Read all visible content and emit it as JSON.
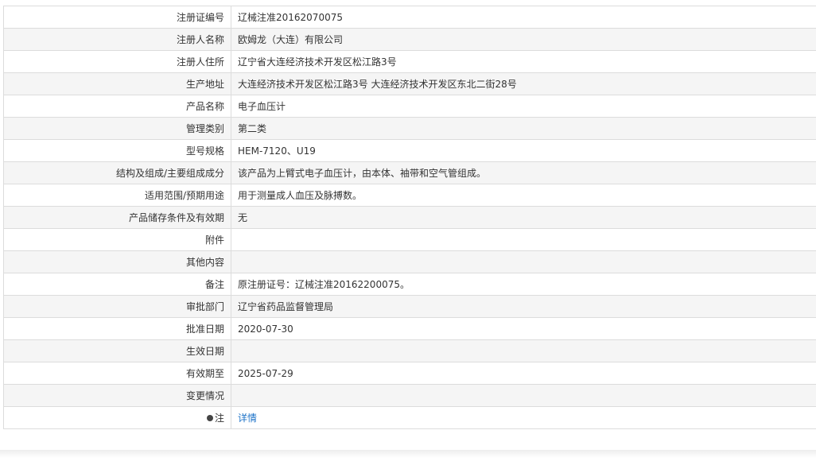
{
  "rows": [
    {
      "label": "注册证编号",
      "value": "辽械注准20162070075"
    },
    {
      "label": "注册人名称",
      "value": "欧姆龙（大连）有限公司"
    },
    {
      "label": "注册人住所",
      "value": "辽宁省大连经济技术开发区松江路3号"
    },
    {
      "label": "生产地址",
      "value": "大连经济技术开发区松江路3号  大连经济技术开发区东北二街28号"
    },
    {
      "label": "产品名称",
      "value": "电子血压计"
    },
    {
      "label": "管理类别",
      "value": "第二类"
    },
    {
      "label": "型号规格",
      "value": "HEM-7120、U19"
    },
    {
      "label": "结构及组成/主要组成成分",
      "value": "该产品为上臂式电子血压计，由本体、袖带和空气管组成。"
    },
    {
      "label": "适用范围/预期用途",
      "value": "用于测量成人血压及脉搏数。"
    },
    {
      "label": "产品储存条件及有效期",
      "value": "无"
    },
    {
      "label": "附件",
      "value": ""
    },
    {
      "label": "其他内容",
      "value": ""
    },
    {
      "label": "备注",
      "value": "原注册证号：辽械注准20162200075。"
    },
    {
      "label": "审批部门",
      "value": "辽宁省药品监督管理局"
    },
    {
      "label": "批准日期",
      "value": "2020-07-30"
    },
    {
      "label": "生效日期",
      "value": ""
    },
    {
      "label": "有效期至",
      "value": "2025-07-29"
    },
    {
      "label": "变更情况",
      "value": ""
    }
  ],
  "note": {
    "label": "注",
    "link_text": "详情",
    "icon": "pin-icon"
  }
}
